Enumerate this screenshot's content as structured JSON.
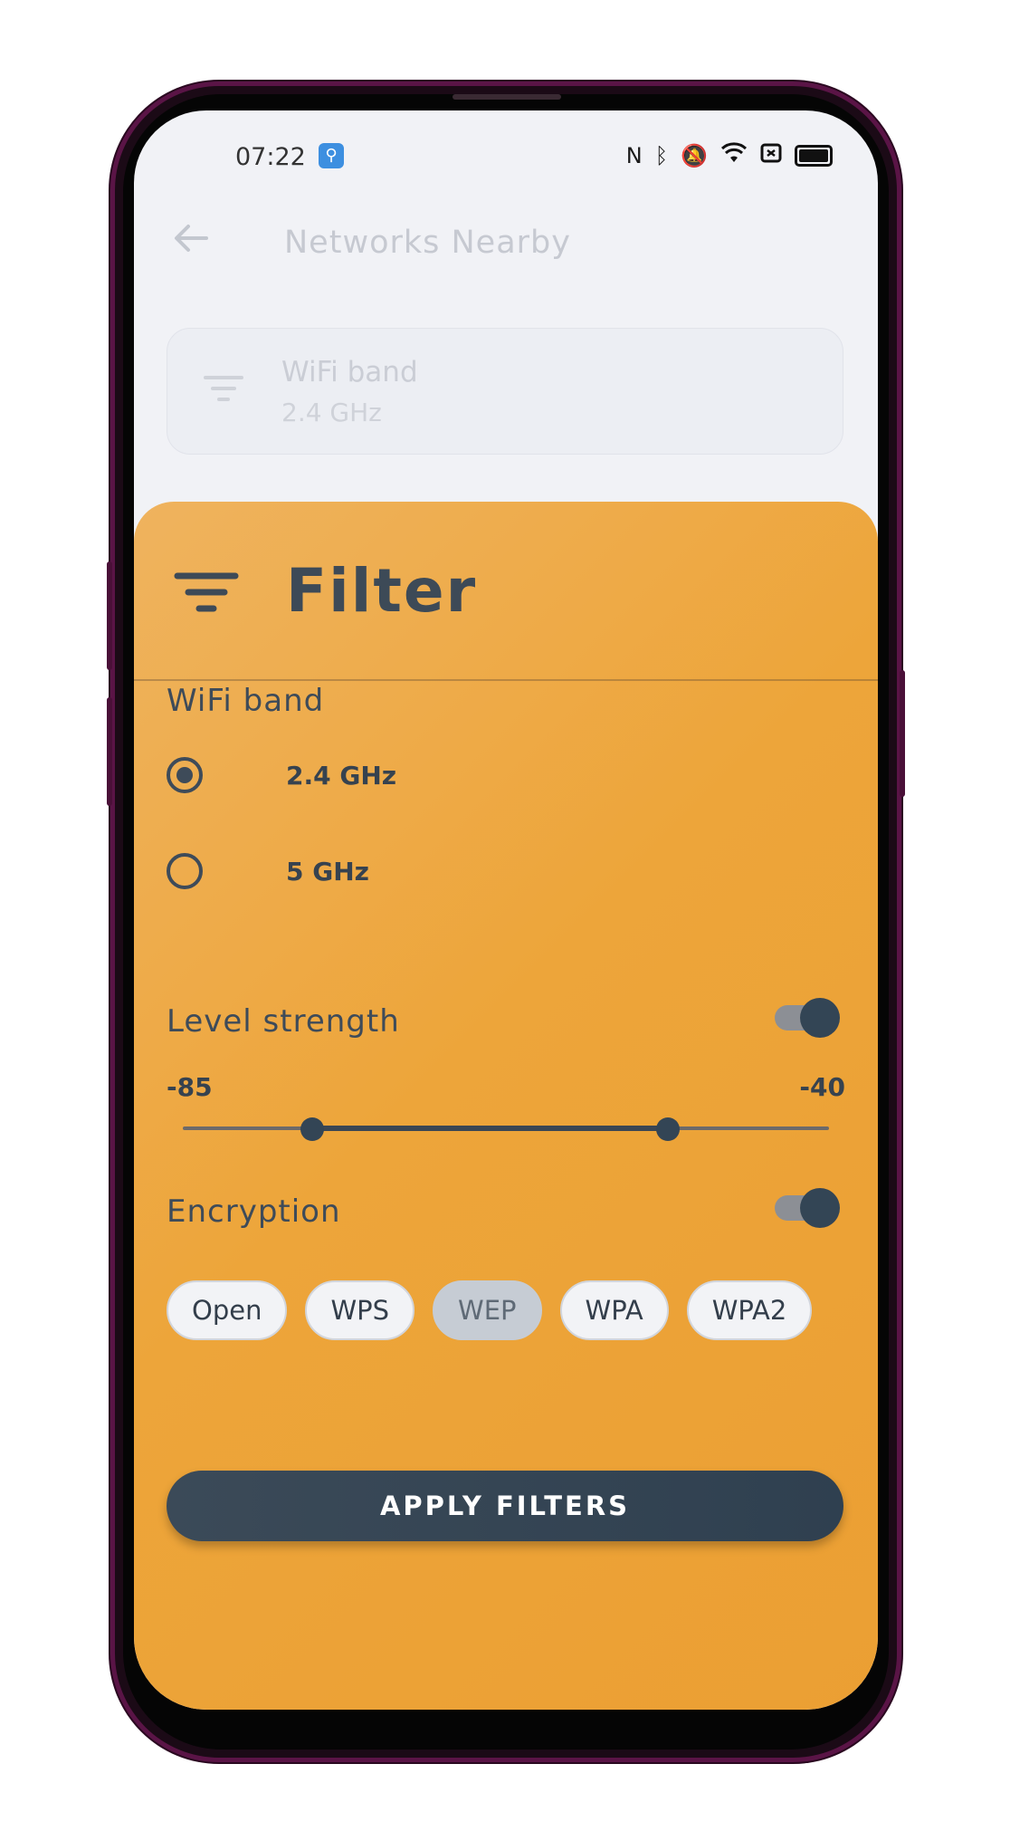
{
  "status_bar": {
    "time": "07:22",
    "icons": [
      "usb-icon",
      "nfc-icon",
      "bluetooth-icon",
      "mute-icon",
      "wifi-icon",
      "sim-icon",
      "battery-icon"
    ]
  },
  "app_bar": {
    "title": "Networks Nearby"
  },
  "filter_card": {
    "label": "WiFi band",
    "value": "2.4 GHz"
  },
  "sheet": {
    "title": "Filter",
    "wifi_band": {
      "label": "WiFi band",
      "options": [
        {
          "label": "2.4 GHz",
          "selected": true
        },
        {
          "label": "5 GHz",
          "selected": false
        }
      ]
    },
    "level_strength": {
      "label": "Level strength",
      "enabled": true,
      "min_label": "-85",
      "max_label": "-40",
      "range_low_fraction": 0.2,
      "range_high_fraction": 0.75
    },
    "encryption": {
      "label": "Encryption",
      "enabled": true,
      "chips": [
        {
          "label": "Open",
          "selected": false
        },
        {
          "label": "WPS",
          "selected": false
        },
        {
          "label": "WEP",
          "selected": true
        },
        {
          "label": "WPA",
          "selected": false
        },
        {
          "label": "WPA2",
          "selected": false
        }
      ]
    },
    "apply_label": "APPLY FILTERS"
  },
  "colors": {
    "sheet_accent": "#eda53a",
    "primary_dark": "#334555",
    "phone_frame": "#5a1446"
  }
}
